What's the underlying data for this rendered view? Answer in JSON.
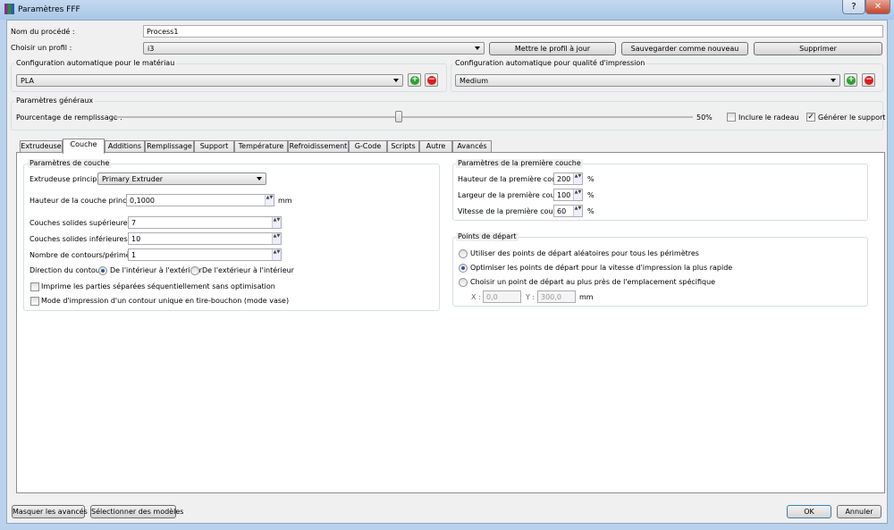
{
  "window": {
    "title": "Paramètres FFF",
    "help_label": "?",
    "close_label": "✕"
  },
  "process": {
    "name_label": "Nom du procédé :",
    "name_value": "Process1",
    "profile_label": "Choisir un profil :",
    "profile_value": "i3",
    "update_label": "Mettre le profil à jour",
    "save_new_label": "Sauvegarder comme nouveau",
    "delete_label": "Supprimer"
  },
  "material": {
    "title": "Configuration automatique pour le matériau",
    "value": "PLA"
  },
  "quality": {
    "title": "Configuration automatique pour qualité d'impression",
    "value": "Medium"
  },
  "general": {
    "title": "Paramètres généraux",
    "infill_label": "Pourcentage de remplissage :",
    "infill_percent": 50,
    "infill_text": "50%",
    "raft_label": "Inclure le radeau",
    "raft_checked": false,
    "support_label": "Générer le support",
    "support_checked": true
  },
  "tabs": [
    "Extrudeuse",
    "Couche",
    "Additions",
    "Remplissage",
    "Support",
    "Température",
    "Refroidissement",
    "G-Code",
    "Scripts",
    "Autre",
    "Avancés"
  ],
  "active_tab": "Couche",
  "layer": {
    "title": "Paramètres de couche",
    "extruder_label": "Extrudeuse principale",
    "extruder_value": "Primary Extruder",
    "height_label": "Hauteur de la couche principale",
    "height_value": "0,1000",
    "height_unit": "mm",
    "top_label": "Couches solides supérieures",
    "top_value": "7",
    "bottom_label": "Couches solides inférieures",
    "bottom_value": "10",
    "perim_label": "Nombre de contours/périmètres",
    "perim_value": "1",
    "direction_label": "Direction du contour :",
    "dir_in_out": "De l'intérieur à l'extérieur",
    "dir_out_in": "De l'extérieur à l'intérieur",
    "sequential_label": "Imprime les parties séparées séquentiellement sans optimisation",
    "vase_label": "Mode d'impression d'un contour unique en tire-bouchon (mode vase)"
  },
  "first_layer": {
    "title": "Paramètres de la première couche",
    "height_label": "Hauteur de la première couche",
    "height_value": "200",
    "width_label": "Largeur de la première couche",
    "width_value": "100",
    "speed_label": "Vitesse de la première couche",
    "speed_value": "60",
    "unit": "%"
  },
  "start_points": {
    "title": "Points de départ",
    "random_label": "Utiliser des points de départ aléatoires pour tous les périmètres",
    "optimize_label": "Optimiser les points de départ pour la vitesse d'impression la plus rapide",
    "specific_label": "Choisir un point de départ au plus près de l'emplacement spécifique",
    "x_label": "X :",
    "x_value": "0,0",
    "y_label": "Y :",
    "y_value": "300,0",
    "unit": "mm"
  },
  "footer": {
    "hide_advanced": "Masquer les avancés",
    "select_models": "Sélectionner des modèles",
    "ok": "OK",
    "cancel": "Annuler"
  }
}
